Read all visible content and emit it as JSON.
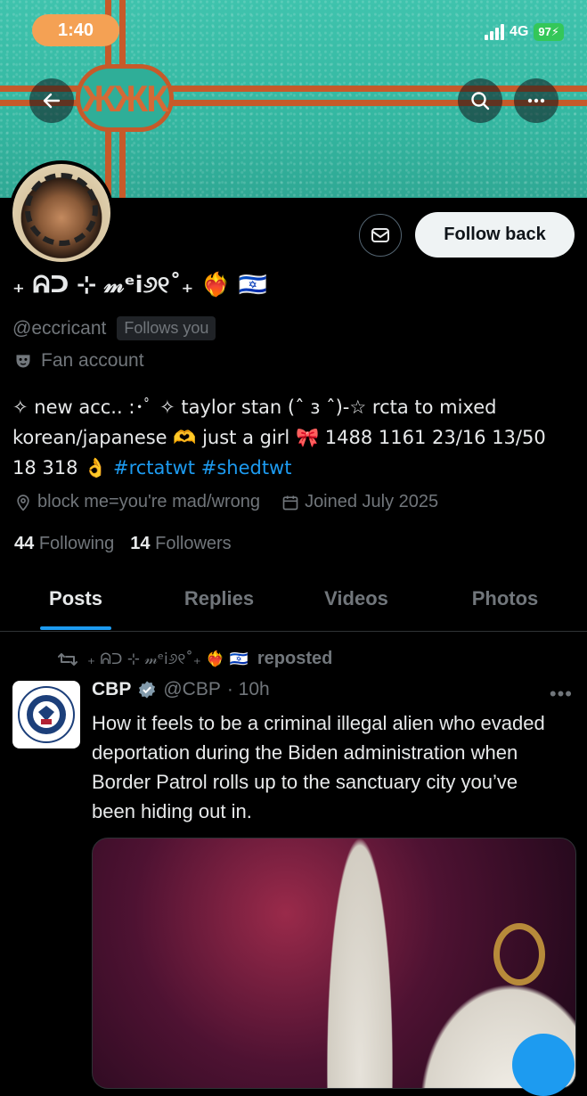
{
  "status_bar": {
    "time": "1:40",
    "network": "4G",
    "battery": "97"
  },
  "banner": {
    "emblem_text": "ЖЖК"
  },
  "profile": {
    "display_name": "₊ ᕱᑐ ⊹ 𝓂ᵉi୬୧˚₊ ❤️‍🔥 🇮🇱",
    "handle": "@eccricant",
    "follows_you": "Follows you",
    "category": "Fan account",
    "bio_text": "✧ new acc.. :･ﾟ ✧ taylor stan (ˆ з ˆ)-☆ rcta to mixed korean/japanese 🫶 just a girl 🎀 1488 1161 23/16 13/50 18 318 👌 ",
    "bio_hashtags": "#rctatwt #shedtwt",
    "location": "block me=you're mad/wrong",
    "joined": "Joined July 2025",
    "following_count": "44",
    "following_label": "Following",
    "followers_count": "14",
    "followers_label": "Followers",
    "follow_button": "Follow back"
  },
  "tabs": [
    {
      "label": "Posts",
      "active": true
    },
    {
      "label": "Replies",
      "active": false
    },
    {
      "label": "Videos",
      "active": false
    },
    {
      "label": "Photos",
      "active": false
    }
  ],
  "post": {
    "repost_by": "₊ ᕱᑐ ⊹ 𝓂ᵉi୬୧˚₊ ❤️‍🔥 🇮🇱",
    "repost_label": "reposted",
    "author_name": "CBP",
    "author_handle": "@CBP",
    "time": "· 10h",
    "text": "How it feels to be a criminal illegal alien who evaded deportation during the Biden administration when Border Patrol rolls up to the sanctuary city you’ve been hiding out in.",
    "avatar_caption": "U.S. CUSTOMS AND BORDER PROTECTION"
  },
  "colors": {
    "accent": "#1d9bf0",
    "background": "#000000",
    "muted": "#71767b",
    "banner": "#3fc3ad"
  },
  "icons": [
    "back-arrow-icon",
    "search-icon",
    "more-icon",
    "mail-icon",
    "mask-icon",
    "location-icon",
    "calendar-icon",
    "retweet-icon",
    "verified-badge-icon"
  ]
}
